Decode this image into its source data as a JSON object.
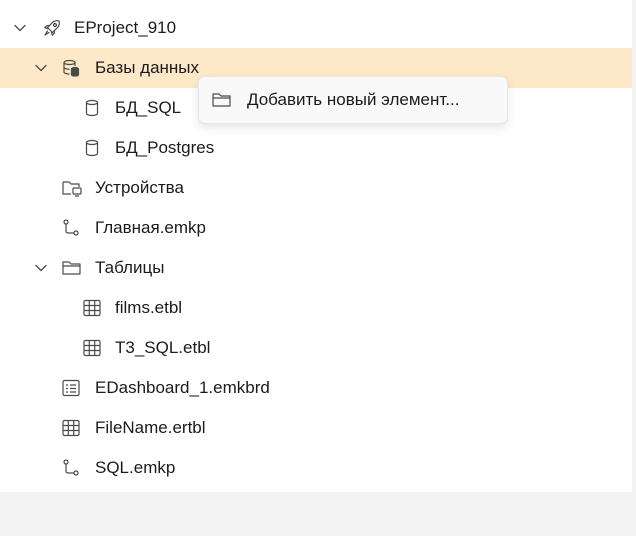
{
  "tree": {
    "project": {
      "label": "EProject_910",
      "icon": "rocket-icon",
      "expanded": true
    },
    "databases": {
      "label": "Базы данных",
      "icon": "database-stack-icon",
      "expanded": true,
      "selected": true
    },
    "db_sql": {
      "label": "БД_SQL",
      "icon": "database-icon"
    },
    "db_postgres": {
      "label": "БД_Postgres",
      "icon": "database-icon"
    },
    "devices": {
      "label": "Устройства",
      "icon": "folder-devices-icon"
    },
    "main_emkp": {
      "label": "Главная.emkp",
      "icon": "flow-icon"
    },
    "tables": {
      "label": "Таблицы",
      "icon": "folder-icon",
      "expanded": true
    },
    "films": {
      "label": "films.etbl",
      "icon": "table-icon"
    },
    "t3_sql": {
      "label": "T3_SQL.etbl",
      "icon": "table-icon"
    },
    "dashboard": {
      "label": "EDashboard_1.emkbrd",
      "icon": "dashboard-icon"
    },
    "filename": {
      "label": "FileName.ertbl",
      "icon": "table-icon"
    },
    "sql_emkp": {
      "label": "SQL.emkp",
      "icon": "flow-icon"
    }
  },
  "context_menu": {
    "items": [
      {
        "label": "Добавить новый элемент...",
        "icon": "folder-icon"
      }
    ]
  },
  "colors": {
    "selected_row": "#fde9c8",
    "icon_stroke": "#4a4a4a",
    "panel_bg": "#ffffff",
    "outer_bg": "#f3f3f3"
  }
}
